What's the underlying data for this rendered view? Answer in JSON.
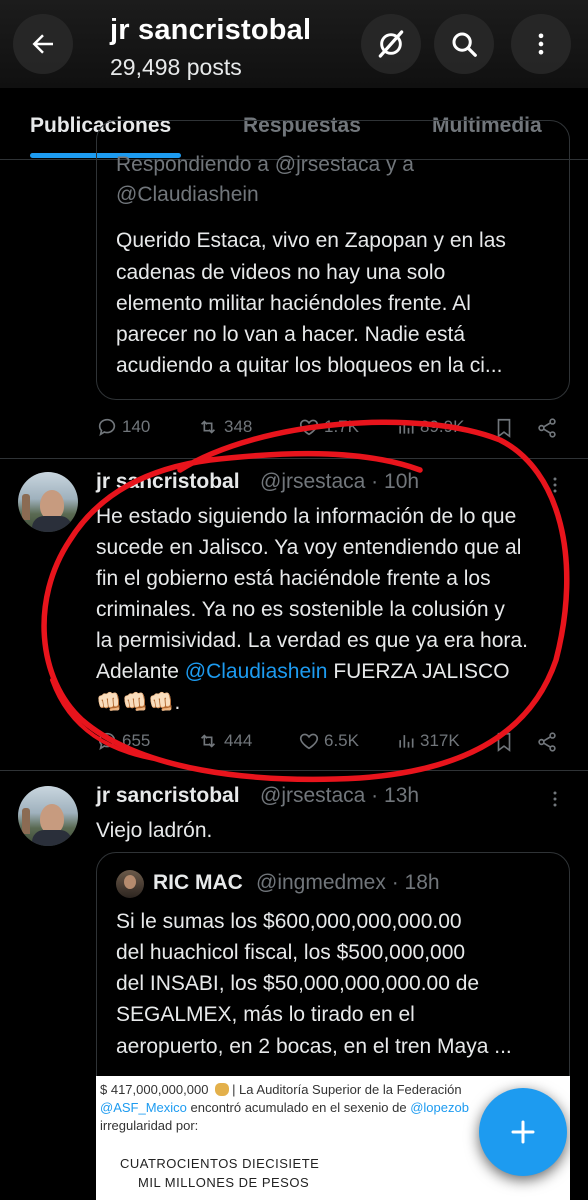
{
  "header": {
    "display_name": "jr sancristobal",
    "posts_count": "29,498 posts",
    "back_icon": "arrow-left-icon",
    "grok_icon": "grok-slash-icon",
    "search_icon": "search-icon",
    "more_icon": "more-vertical-icon"
  },
  "tabs": [
    {
      "label": "Publicaciones",
      "active": true
    },
    {
      "label": "Respuestas",
      "active": false
    },
    {
      "label": "Multimedia",
      "active": false
    }
  ],
  "post0": {
    "quote": {
      "replying_line1": "Respondiendo a @jrsestaca y a",
      "replying_line2": "@Claudiashein",
      "lines": [
        "Querido Estaca, vivo en Zapopan y en las",
        "cadenas de videos no hay una solo",
        "elemento militar haciéndoles frente. Al",
        "parecer no lo van a hacer. Nadie está",
        "acudiendo a quitar los bloqueos en la ci..."
      ]
    },
    "actions": {
      "replies": "140",
      "reposts": "348",
      "likes": "1.7K",
      "views": "89.9K"
    }
  },
  "post1": {
    "name": "jr sancristobal",
    "handle": "@jrsestaca · 10h",
    "lines": [
      "He estado siguiendo la información de lo que",
      "sucede en Jalisco. Ya voy entendiendo que al",
      "fin el gobierno está haciéndole frente a los",
      "criminales. Ya no es sostenible la colusión y",
      "la permisividad. La verdad es que ya era hora."
    ],
    "line6_prefix": "Adelante ",
    "line6_mention": "@Claudiashein",
    "line6_suffix": " FUERZA JALISCO",
    "emoji_line": "👊🏻👊🏻👊🏻.",
    "actions": {
      "replies": "655",
      "reposts": "444",
      "likes": "6.5K",
      "views": "317K"
    }
  },
  "post2": {
    "name": "jr sancristobal",
    "handle": "@jrsestaca · 13h",
    "text": "Viejo ladrón.",
    "quote": {
      "name": "RIC MAC",
      "handle": "@ingmedmex · 18h",
      "lines": [
        "Si le sumas los $600,000,000,000.00",
        "del huachicol fiscal, los $500,000,000",
        "del INSABI, los $50,000,000,000.00 de",
        "SEGALMEX, más lo tirado en el",
        "aeropuerto, en 2 bocas, en el tren Maya ..."
      ],
      "image": {
        "line1_amount": "$ 417,000,000,000",
        "line1_rest": "| La Auditoría Superior de la Federación",
        "line2_link1": "@ASF_Mexico",
        "line2_mid": " encontró acumulado en el sexenio de ",
        "line2_link2": "@lopezob",
        "line3": "irregularidad por:",
        "big1": "CUATROCIENTOS DIECISIETE",
        "big2": "MIL MILLONES DE PESOS"
      }
    }
  },
  "fab": {
    "label": "+"
  },
  "colors": {
    "accent": "#1d9bf0",
    "annotation": "#e8141c",
    "muted": "#71767b"
  }
}
